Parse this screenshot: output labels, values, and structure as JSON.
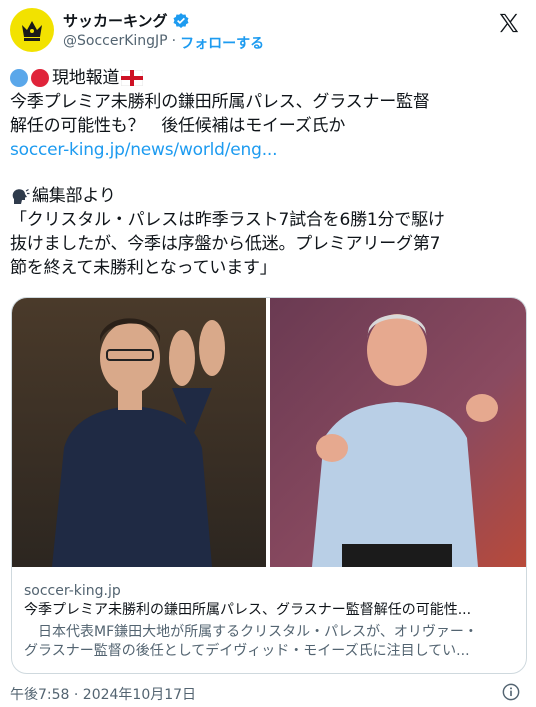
{
  "account": {
    "display_name": "サッカーキング",
    "handle": "@SoccerKingJP",
    "separator": "·",
    "follow_label": "フォローする"
  },
  "tweet": {
    "line1_label": "現地報道",
    "line2": "今季プレミア未勝利の鎌田所属パレス、グラスナー監督",
    "line3": "解任の可能性も？　後任候補はモイーズ氏か",
    "link_text": "soccer-king.jp/news/world/eng...",
    "editor_label": "編集部より",
    "quote1": "「クリスタル・パレスは昨季ラスト7試合を6勝1分で駆け",
    "quote2": "抜けましたが、今季は序盤から低迷。プレミアリーグ第7",
    "quote3": "節を終えて未勝利となっています」"
  },
  "card": {
    "domain": "soccer-king.jp",
    "title": "今季プレミア未勝利の鎌田所属パレス、グラスナー監督解任の可能性...",
    "desc1": "　日本代表MF鎌田大地が所属するクリスタル・パレスが、オリヴァー・",
    "desc2": "グラスナー監督の後任としてデイヴィッド・モイーズ氏に注目してい..."
  },
  "footer": {
    "timestamp": "午後7:58 · 2024年10月17日"
  },
  "colors": {
    "accent": "#1d9bf0",
    "avatar_bg": "#f2e200",
    "dot_blue": "#5aa7ea",
    "dot_red": "#e0243a"
  },
  "icons": [
    "crown-icon",
    "verified-badge-icon",
    "x-logo-icon",
    "blue-circle-icon",
    "red-circle-icon",
    "england-flag-icon",
    "speaking-head-icon",
    "info-icon"
  ]
}
